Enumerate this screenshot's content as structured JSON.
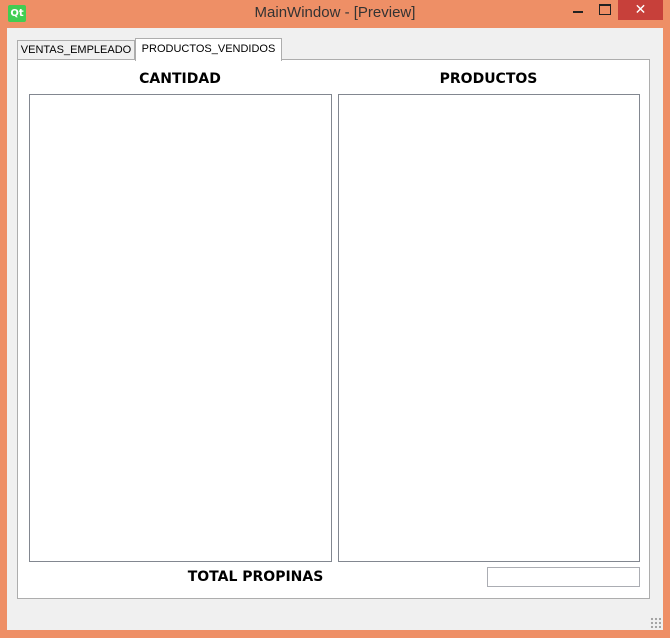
{
  "window": {
    "title": "MainWindow - [Preview]",
    "icon": "qt-logo-icon",
    "icon_text": "Qt",
    "close_glyph": "✕",
    "accent": "#EE8F66",
    "close_color": "#C7403A"
  },
  "tabs": [
    {
      "label": "VENTAS_EMPLEADO",
      "active": false
    },
    {
      "label": "PRODUCTOS_VENDIDOS",
      "active": true
    }
  ],
  "main": {
    "cantidad_heading": "CANTIDAD",
    "productos_heading": "PRODUCTOS",
    "cantidad_items": [],
    "productos_items": [],
    "total_label": "TOTAL PROPINAS",
    "total_value": ""
  }
}
